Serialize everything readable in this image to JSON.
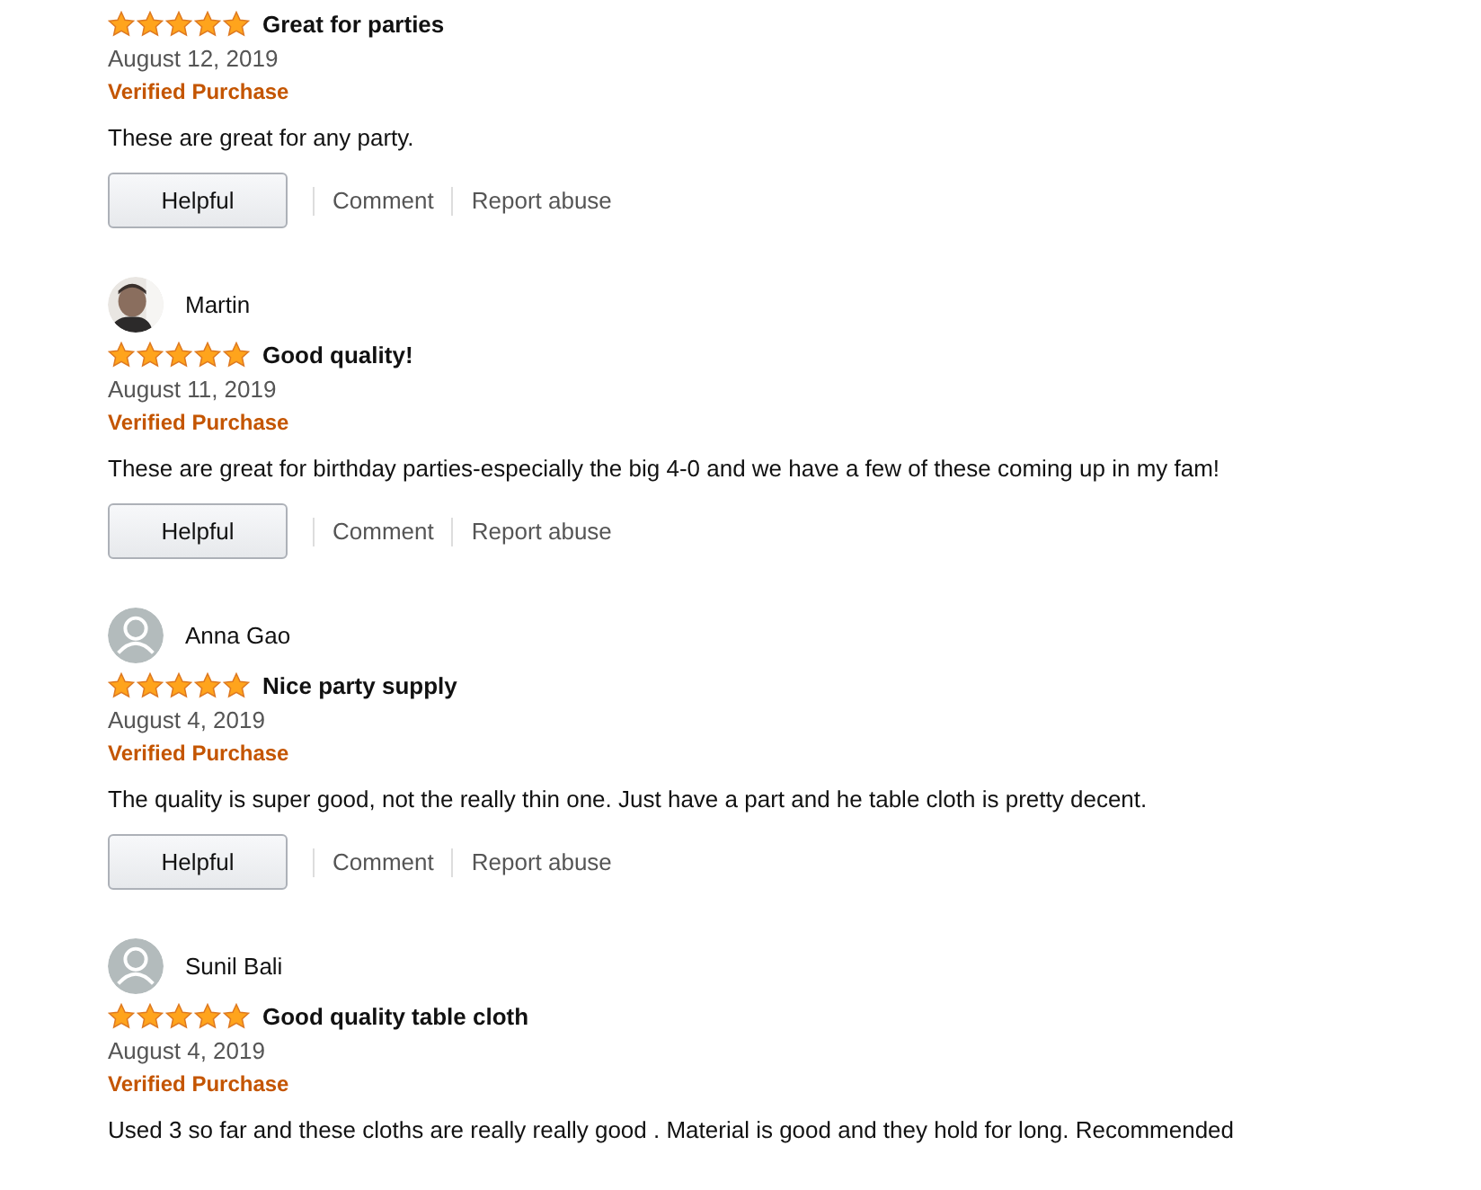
{
  "reviews": [
    {
      "title": "Great for parties",
      "stars": 5,
      "date": "August 12, 2019",
      "badge": "Verified Purchase",
      "body": "These are great for any party.",
      "actions": {
        "helpful": "Helpful",
        "comment": "Comment",
        "report": "Report abuse"
      }
    },
    {
      "author": {
        "name": "Martin"
      },
      "title": "Good quality!",
      "stars": 5,
      "date": "August 11, 2019",
      "badge": "Verified Purchase",
      "body": "These are great for birthday parties-especially the big 4-0 and we have a few of these coming up in my fam!",
      "actions": {
        "helpful": "Helpful",
        "comment": "Comment",
        "report": "Report abuse"
      }
    },
    {
      "author": {
        "name": "Anna Gao",
        "avatar": {
          "kind": "icon"
        }
      },
      "title": "Nice party supply",
      "stars": 5,
      "date": "August 4, 2019",
      "badge": "Verified Purchase",
      "body": "The quality is super good, not the really thin one. Just have a part and he table cloth is pretty decent.",
      "actions": {
        "helpful": "Helpful",
        "comment": "Comment",
        "report": "Report abuse"
      }
    },
    {
      "author": {
        "name": "Sunil Bali",
        "avatar": {
          "kind": "icon"
        }
      },
      "title": "Good quality table cloth",
      "stars": 5,
      "date": "August 4, 2019",
      "badge": "Verified Purchase",
      "body": "Used 3 so far and these cloths are really really good . Material is good and they hold for long. Recommended"
    }
  ]
}
